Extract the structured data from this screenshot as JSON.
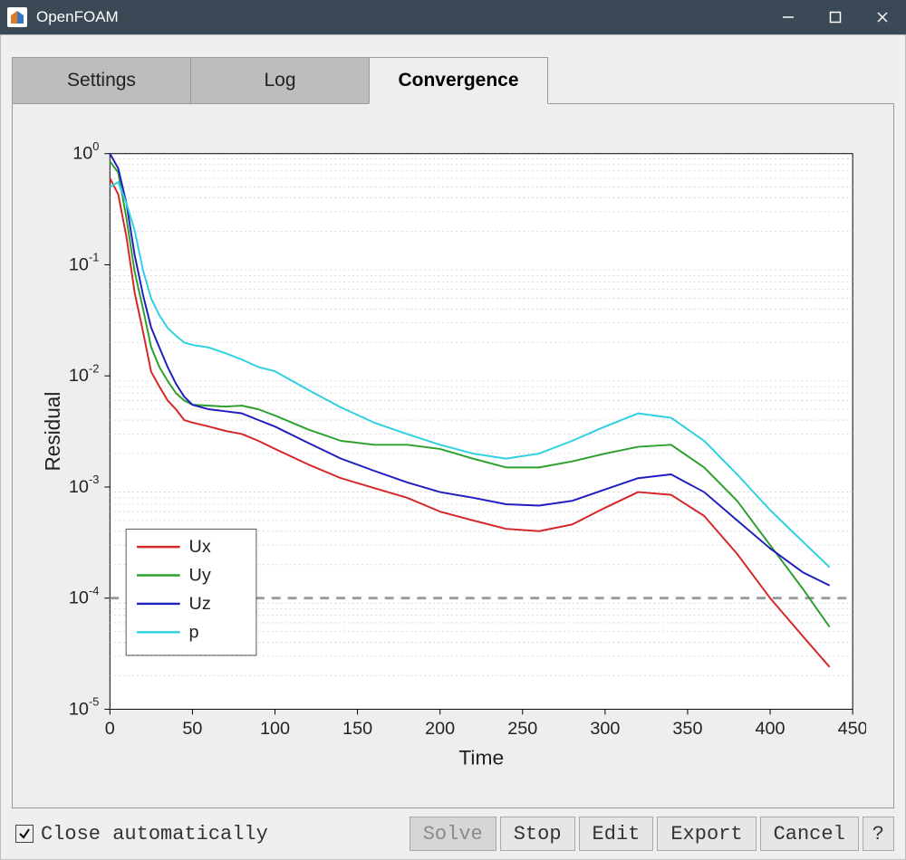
{
  "window": {
    "title": "OpenFOAM"
  },
  "tabs": [
    {
      "label": "Settings",
      "active": false
    },
    {
      "label": "Log",
      "active": false
    },
    {
      "label": "Convergence",
      "active": true
    }
  ],
  "checkbox": {
    "label": "Close automatically",
    "checked": true
  },
  "buttons": {
    "solve": {
      "label": "Solve",
      "enabled": false
    },
    "stop": {
      "label": "Stop",
      "enabled": true
    },
    "edit": {
      "label": "Edit",
      "enabled": true
    },
    "export": {
      "label": "Export",
      "enabled": true
    },
    "cancel": {
      "label": "Cancel",
      "enabled": true
    },
    "help": {
      "label": "?",
      "enabled": true
    }
  },
  "chart_data": {
    "type": "line",
    "title": "",
    "xlabel": "Time",
    "ylabel": "Residual",
    "xlim": [
      0,
      450
    ],
    "ylim": [
      1e-05,
      1
    ],
    "yscale": "log",
    "xticks": [
      0,
      50,
      100,
      150,
      200,
      250,
      300,
      350,
      400,
      450
    ],
    "ytick_exponents": [
      0,
      -1,
      -2,
      -3,
      -4,
      -5
    ],
    "threshold": 0.0001,
    "legend": [
      "Ux",
      "Uy",
      "Uz",
      "p"
    ],
    "colors": {
      "Ux": "#d62728",
      "Uy": "#2ca02c",
      "Uz": "#1f1fbf",
      "p": "#2fd0e0"
    },
    "x": [
      0,
      5,
      10,
      15,
      20,
      25,
      30,
      35,
      40,
      45,
      50,
      60,
      70,
      80,
      90,
      100,
      120,
      140,
      160,
      180,
      200,
      220,
      240,
      260,
      280,
      300,
      320,
      340,
      360,
      380,
      400,
      420,
      436
    ],
    "series": [
      {
        "name": "Ux",
        "values": [
          0.6,
          0.35,
          0.15,
          0.055,
          0.028,
          0.012,
          0.008,
          0.006,
          0.005,
          0.004,
          0.0038,
          0.0035,
          0.0032,
          0.003,
          0.0026,
          0.0022,
          0.0016,
          0.0012,
          0.00098,
          0.0008,
          0.0006,
          0.0005,
          0.00042,
          0.0004,
          0.00046,
          0.00065,
          0.0009,
          0.00085,
          0.00055,
          0.00025,
          0.0001,
          4.5e-05,
          2.4e-05
        ]
      },
      {
        "name": "Uy",
        "values": [
          0.85,
          0.55,
          0.22,
          0.085,
          0.045,
          0.02,
          0.012,
          0.009,
          0.007,
          0.006,
          0.0055,
          0.0054,
          0.0053,
          0.0054,
          0.005,
          0.0044,
          0.0033,
          0.0026,
          0.0024,
          0.0024,
          0.0022,
          0.0018,
          0.0015,
          0.0015,
          0.0017,
          0.002,
          0.0023,
          0.0024,
          0.0015,
          0.00075,
          0.0003,
          0.00012,
          5.5e-05
        ]
      },
      {
        "name": "Uz",
        "values": [
          1.0,
          0.6,
          0.3,
          0.12,
          0.06,
          0.03,
          0.018,
          0.012,
          0.0085,
          0.0065,
          0.0055,
          0.005,
          0.0048,
          0.0046,
          0.004,
          0.0035,
          0.0025,
          0.0018,
          0.0014,
          0.0011,
          0.0009,
          0.0008,
          0.0007,
          0.00068,
          0.00075,
          0.00095,
          0.0012,
          0.0013,
          0.0009,
          0.0005,
          0.00028,
          0.00017,
          0.00013
        ]
      },
      {
        "name": "p",
        "values": [
          0.5,
          0.45,
          0.3,
          0.2,
          0.1,
          0.055,
          0.035,
          0.027,
          0.023,
          0.02,
          0.019,
          0.018,
          0.016,
          0.014,
          0.012,
          0.011,
          0.0075,
          0.0052,
          0.0038,
          0.003,
          0.0024,
          0.002,
          0.0018,
          0.002,
          0.0026,
          0.0035,
          0.0046,
          0.0042,
          0.0026,
          0.0013,
          0.00062,
          0.00032,
          0.00019
        ]
      }
    ]
  }
}
